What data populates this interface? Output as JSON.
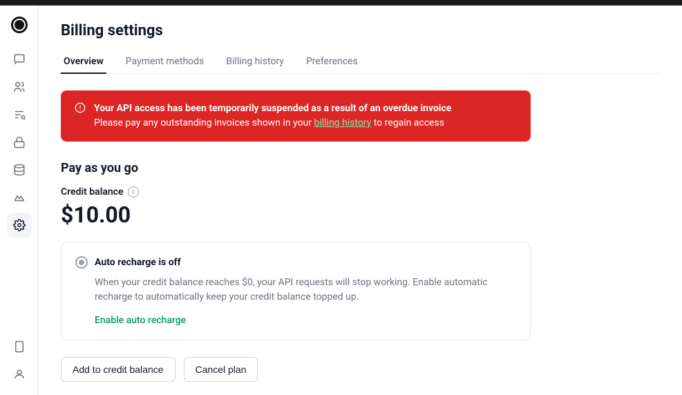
{
  "topbar": {},
  "sidebar": {
    "logo_alt": "OpenAI logo",
    "icons": [
      {
        "name": "chat-icon",
        "symbol": "▤",
        "active": false
      },
      {
        "name": "user-icon",
        "symbol": "◎",
        "active": false
      },
      {
        "name": "sliders-icon",
        "symbol": "⇌",
        "active": false
      },
      {
        "name": "lock-icon",
        "symbol": "⬡",
        "active": false
      },
      {
        "name": "database-icon",
        "symbol": "◫",
        "active": false
      },
      {
        "name": "chart-icon",
        "symbol": "⬟",
        "active": false
      },
      {
        "name": "settings-icon",
        "symbol": "✿",
        "active": true
      }
    ],
    "bottom_icons": [
      {
        "name": "tablet-icon",
        "symbol": "▭"
      },
      {
        "name": "profile-icon",
        "symbol": "⊙"
      }
    ]
  },
  "page": {
    "title": "Billing settings",
    "tabs": [
      {
        "label": "Overview",
        "active": true
      },
      {
        "label": "Payment methods",
        "active": false
      },
      {
        "label": "Billing history",
        "active": false
      },
      {
        "label": "Preferences",
        "active": false
      }
    ]
  },
  "alert": {
    "line1_pre": "Your API access has been temporarily suspended as a result of an overdue invoice",
    "line2_pre": "Please pay any outstanding invoices shown in your ",
    "link_text": "billing history",
    "line2_post": " to regain access"
  },
  "billing": {
    "section_title": "Pay as you go",
    "credit_label": "Credit balance",
    "credit_amount": "$10.00",
    "recharge_title": "Auto recharge is off",
    "recharge_desc": "When your credit balance reaches $0, your API requests will stop working. Enable automatic recharge to automatically keep your credit balance topped up.",
    "enable_link": "Enable auto recharge",
    "btn_add": "Add to credit balance",
    "btn_cancel": "Cancel plan"
  }
}
